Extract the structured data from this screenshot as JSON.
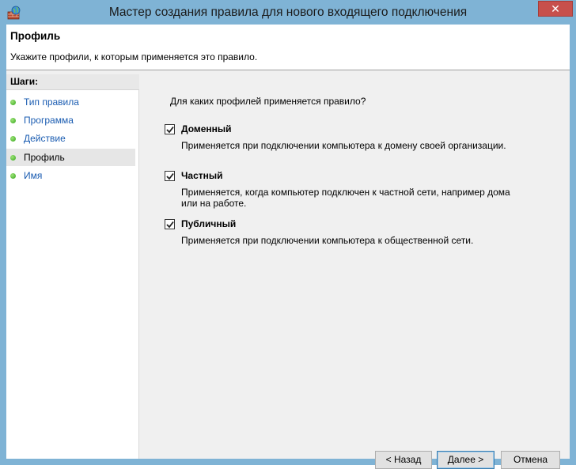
{
  "window": {
    "title": "Мастер создания правила для нового входящего подключения",
    "close_glyph": "✕"
  },
  "header": {
    "title": "Профиль",
    "subtitle": "Укажите профили, к которым применяется это правило."
  },
  "steps": {
    "heading": "Шаги:",
    "items": [
      {
        "label": "Тип правила",
        "active": false
      },
      {
        "label": "Программа",
        "active": false
      },
      {
        "label": "Действие",
        "active": false
      },
      {
        "label": "Профиль",
        "active": true
      },
      {
        "label": "Имя",
        "active": false
      }
    ]
  },
  "content": {
    "question": "Для каких профилей применяется правило?",
    "options": [
      {
        "label": "Доменный",
        "checked": true,
        "description": "Применяется при подключении компьютера к домену своей организации."
      },
      {
        "label": "Частный",
        "checked": true,
        "description": "Применяется, когда компьютер подключен к частной сети, например дома или на работе."
      },
      {
        "label": "Публичный",
        "checked": true,
        "description": "Применяется при подключении компьютера к общественной сети."
      }
    ]
  },
  "buttons": {
    "back": "< Назад",
    "next": "Далее >",
    "cancel": "Отмена"
  },
  "colors": {
    "frame": "#7fb3d5",
    "close": "#c7504c",
    "link": "#1a5cb1",
    "dot": "#35a81c"
  }
}
